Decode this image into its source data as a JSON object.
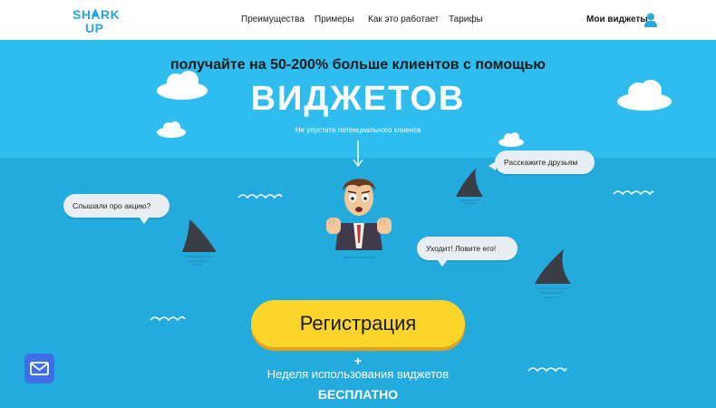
{
  "header": {
    "logo_line1": "SHARK",
    "logo_line2": "UP",
    "nav": [
      {
        "label": "Преимущества"
      },
      {
        "label": "Примеры"
      },
      {
        "label": "Как это работает"
      },
      {
        "label": "Тарифы"
      }
    ],
    "my_widgets": "Мои виджеты"
  },
  "hero": {
    "headline": "получайте на 50-200% больше клиентов с помощью",
    "title": "ВИДЖЕТОВ",
    "subtitle": "Не упустите потенциального клиента"
  },
  "bubbles": {
    "promo": "Слышали про акцию?",
    "tell_friends": "Расскажите друзьям",
    "leaving": "Уходит! Ловите его!"
  },
  "cta": {
    "register": "Регистрация",
    "plus": "+",
    "week": "Неделя использования виджетов",
    "free": "БЕСПЛАТНО"
  },
  "colors": {
    "sky": "#2ebdee",
    "sea": "#22abdc",
    "button": "#fcd52a",
    "brand": "#2aa7df",
    "mail_button": "#3f6ee8"
  },
  "icons": {
    "user": "user-icon",
    "mail": "mail-icon",
    "arrow": "arrow-down-icon"
  }
}
